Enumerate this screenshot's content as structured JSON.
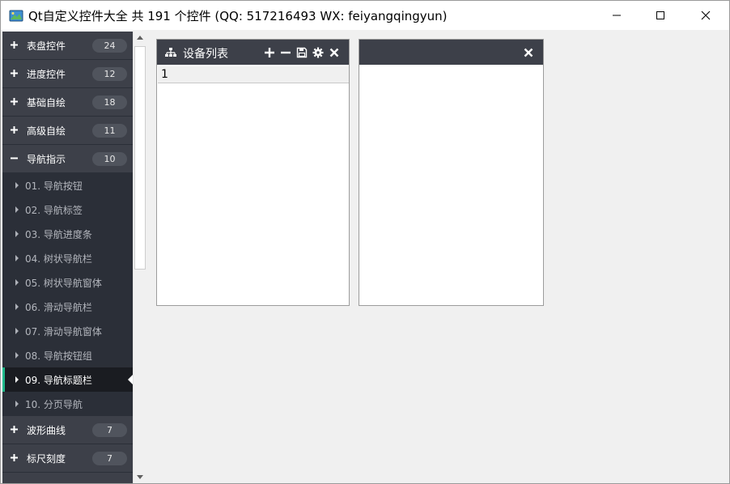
{
  "window": {
    "title": "Qt自定义控件大全 共 191 个控件 (QQ: 517216493 WX: feiyangqingyun)"
  },
  "sidebar": {
    "groups_top": [
      {
        "label": "表盘控件",
        "count": "24",
        "expanded": false
      },
      {
        "label": "进度控件",
        "count": "12",
        "expanded": false
      },
      {
        "label": "基础自绘",
        "count": "18",
        "expanded": false
      },
      {
        "label": "高级自绘",
        "count": "11",
        "expanded": false
      },
      {
        "label": "导航指示",
        "count": "10",
        "expanded": true
      }
    ],
    "items": [
      {
        "label": "01. 导航按钮"
      },
      {
        "label": "02. 导航标签"
      },
      {
        "label": "03. 导航进度条"
      },
      {
        "label": "04. 树状导航栏"
      },
      {
        "label": "05. 树状导航窗体"
      },
      {
        "label": "06. 滑动导航栏"
      },
      {
        "label": "07. 滑动导航窗体"
      },
      {
        "label": "08. 导航按钮组"
      },
      {
        "label": "09. 导航标题栏",
        "active": true
      },
      {
        "label": "10. 分页导航"
      }
    ],
    "groups_bottom": [
      {
        "label": "波形曲线",
        "count": "7",
        "expanded": false
      },
      {
        "label": "标尺刻度",
        "count": "7",
        "expanded": false
      }
    ]
  },
  "panel_a": {
    "title": "设备列表",
    "title_icon": "sitemap-icon",
    "actions": [
      "plus-icon",
      "minus-icon",
      "save-icon",
      "gear-icon",
      "close-icon"
    ],
    "rows": [
      "1"
    ]
  },
  "panel_b": {
    "title": "",
    "actions": [
      "close-icon"
    ]
  },
  "colors": {
    "sidebar_bg": "#2b2f38",
    "group_bg": "#3d4049",
    "accent": "#1fb88a",
    "panel_header": "#3d4049"
  }
}
